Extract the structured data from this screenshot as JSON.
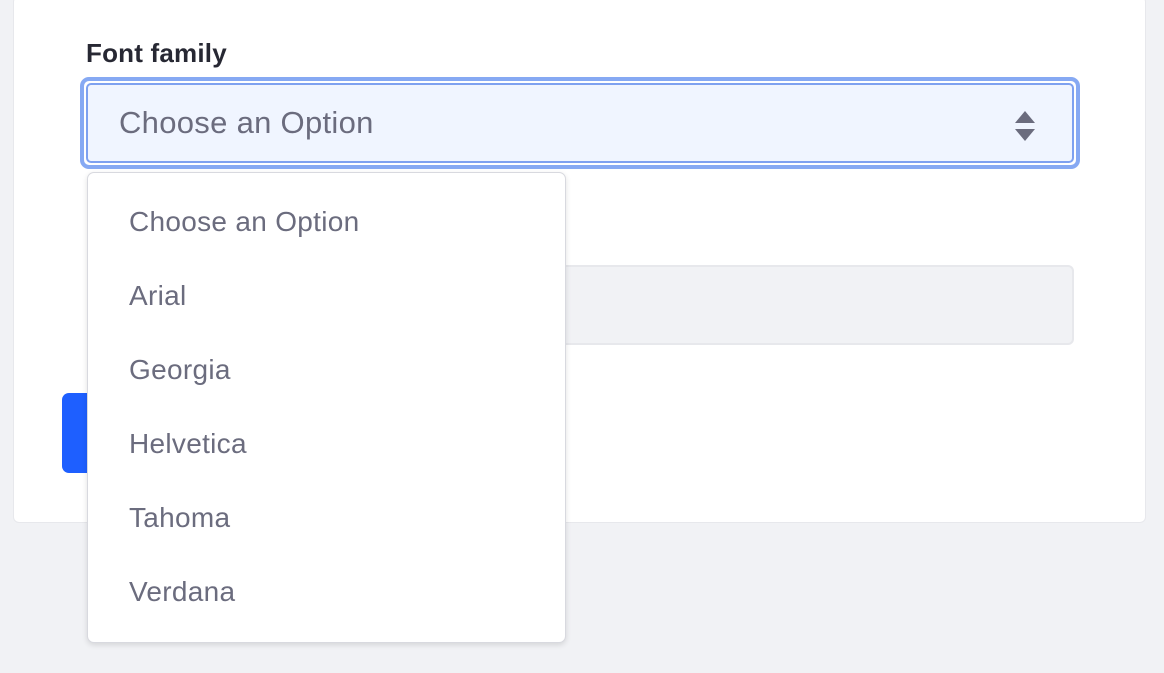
{
  "form": {
    "font_family_label": "Font family",
    "select": {
      "selected_value": "Choose an Option",
      "options": [
        "Choose an Option",
        "Arial",
        "Georgia",
        "Helvetica",
        "Tahoma",
        "Verdana"
      ]
    }
  },
  "colors": {
    "focus_ring": "#86a9f3",
    "primary_button": "#1e5fff",
    "page_background": "#f1f2f5"
  }
}
